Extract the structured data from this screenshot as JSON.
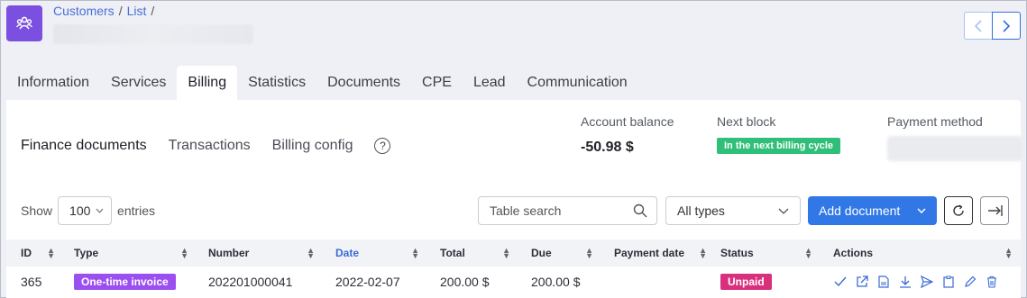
{
  "breadcrumb": [
    "Customers",
    "List"
  ],
  "tabs": [
    "Information",
    "Services",
    "Billing",
    "Statistics",
    "Documents",
    "CPE",
    "Lead",
    "Communication"
  ],
  "subtabs": [
    "Finance documents",
    "Transactions",
    "Billing config"
  ],
  "account": {
    "balance_label": "Account balance",
    "balance_value": "-50.98 $",
    "next_block_label": "Next block",
    "next_block_value": "In the next billing cycle",
    "payment_method_label": "Payment method"
  },
  "toolbar": {
    "show_label": "Show",
    "entries_value": "100",
    "entries_label": "entries",
    "search_placeholder": "Table search",
    "types_value": "All types",
    "add_label": "Add document"
  },
  "table": {
    "columns": [
      "ID",
      "Type",
      "Number",
      "Date",
      "Total",
      "Due",
      "Payment date",
      "Status",
      "Actions"
    ],
    "rows": [
      {
        "id": "365",
        "type": "One-time invoice",
        "number": "202201000041",
        "date": "2022-02-07",
        "total": "200.00 $",
        "due": "200.00 $",
        "payment_date": "",
        "status": "Unpaid"
      }
    ]
  },
  "colors": {
    "accent": "#3178e6",
    "brand": "#7b4fe0",
    "status_unpaid": "#d9307e",
    "type_invoice": "#9b4ff0",
    "badge_green": "#2fbf79"
  }
}
